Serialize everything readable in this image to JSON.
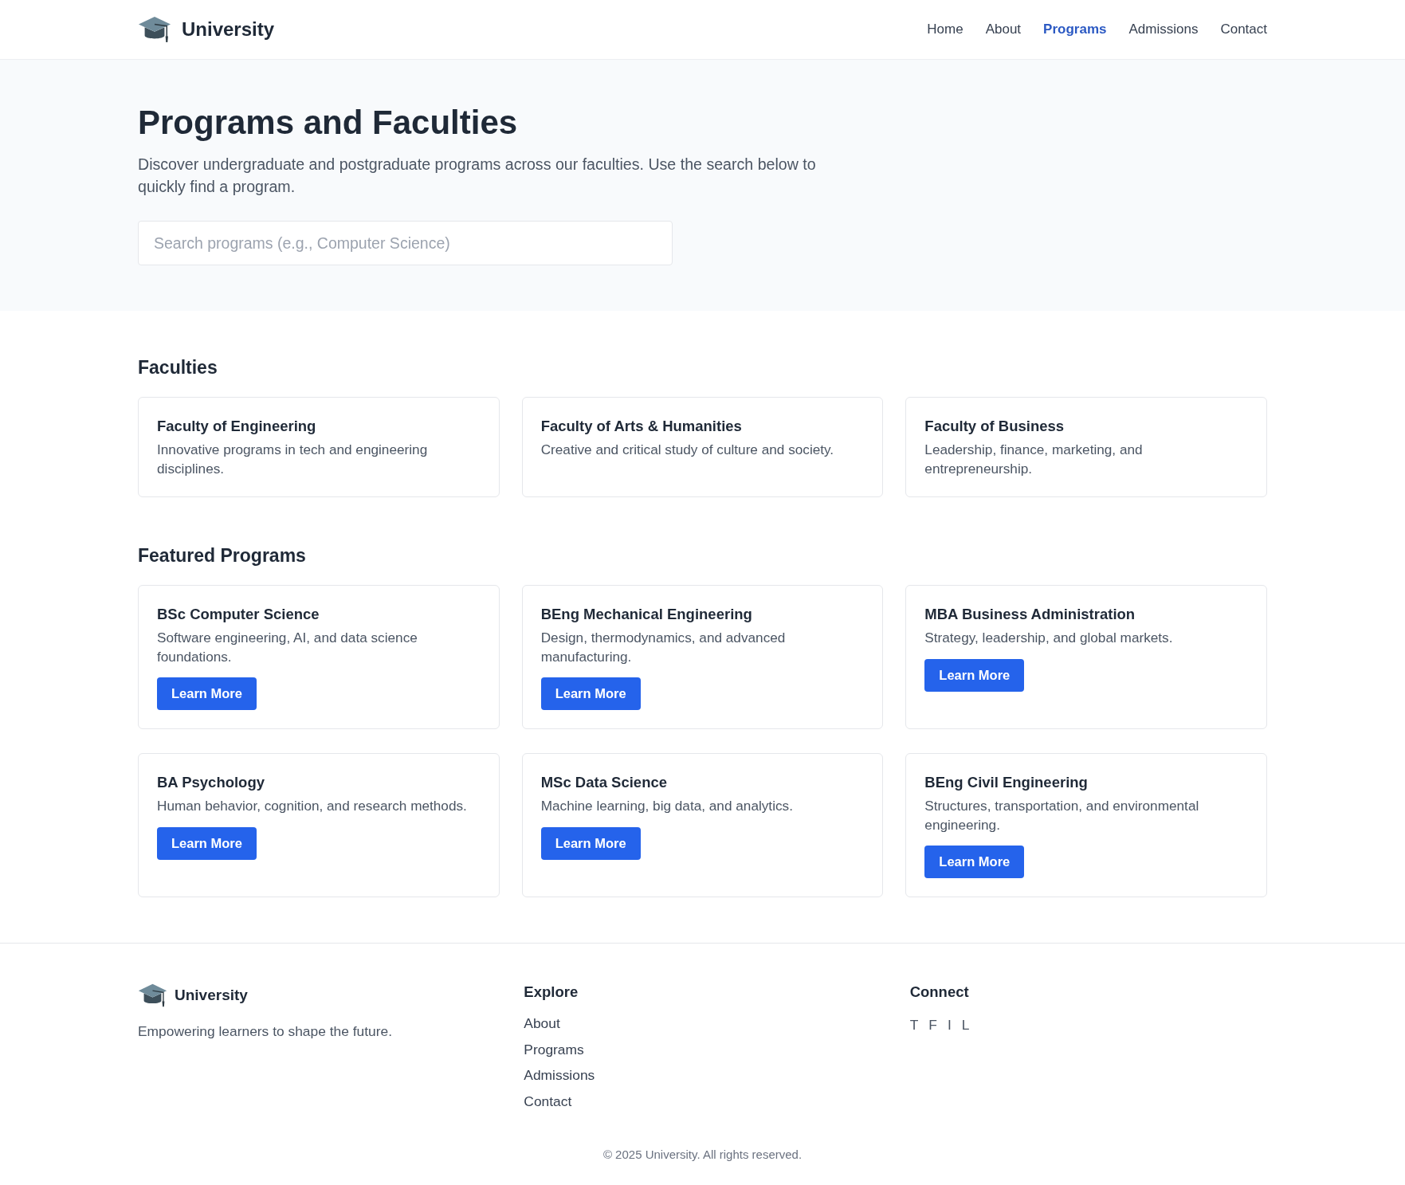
{
  "header": {
    "brand": "University",
    "nav": [
      {
        "label": "Home",
        "selected": false
      },
      {
        "label": "About",
        "selected": false
      },
      {
        "label": "Programs",
        "selected": true
      },
      {
        "label": "Admissions",
        "selected": false
      },
      {
        "label": "Contact",
        "selected": false
      }
    ]
  },
  "hero": {
    "title": "Programs and Faculties",
    "description": "Discover undergraduate and postgraduate programs across our faculties. Use the search below to quickly find a program.",
    "search": {
      "placeholder": "Search programs (e.g., Computer Science)"
    }
  },
  "faculties": {
    "heading": "Faculties",
    "cards": [
      {
        "title": "Faculty of Engineering",
        "description": "Innovative programs in tech and engineering disciplines."
      },
      {
        "title": "Faculty of Arts & Humanities",
        "description": "Creative and critical study of culture and society."
      },
      {
        "title": "Faculty of Business",
        "description": "Leadership, finance, marketing, and entrepreneurship."
      }
    ]
  },
  "featured_programs": {
    "heading": "Featured Programs",
    "cards": [
      {
        "title": "BSc Computer Science",
        "description": "Software engineering, AI, and data science foundations.",
        "button": "Learn More"
      },
      {
        "title": "BEng Mechanical Engineering",
        "description": "Design, thermodynamics, and advanced manufacturing.",
        "button": "Learn More"
      },
      {
        "title": "MBA Business Administration",
        "description": "Strategy, leadership, and global markets.",
        "button": "Learn More"
      },
      {
        "title": "BA Psychology",
        "description": "Human behavior, cognition, and research methods.",
        "button": "Learn More"
      },
      {
        "title": "MSc Data Science",
        "description": "Machine learning, big data, and analytics.",
        "button": "Learn More"
      },
      {
        "title": "BEng Civil Engineering",
        "description": "Structures, transportation, and environmental engineering.",
        "button": "Learn More"
      }
    ]
  },
  "footer": {
    "brand": "University",
    "tagline": "Empowering learners to shape the future.",
    "explore": {
      "heading": "Explore",
      "links": [
        "About",
        "Programs",
        "Admissions",
        "Contact"
      ]
    },
    "connect": {
      "heading": "Connect",
      "links": [
        "T",
        "F",
        "I",
        "L"
      ]
    },
    "copyright": "© 2025 University. All rights reserved."
  }
}
